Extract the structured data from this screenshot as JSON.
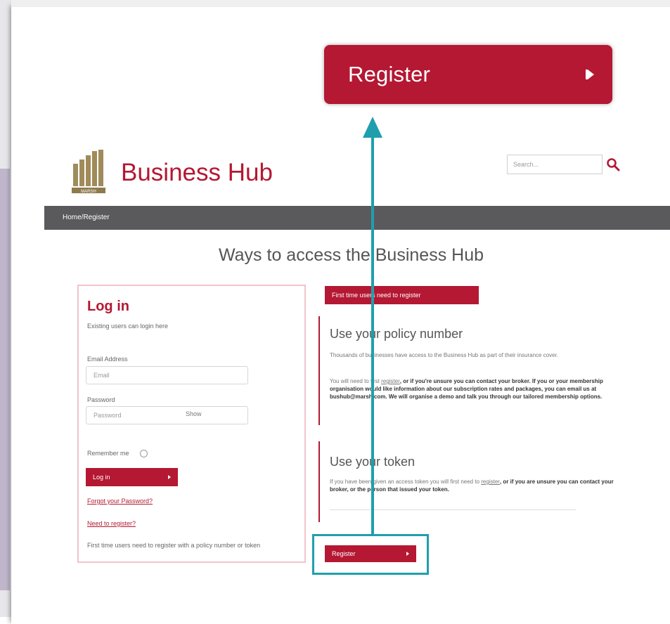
{
  "callout": {
    "register_label": "Register"
  },
  "header": {
    "logo_text": "MARSH",
    "site_title": "Business Hub",
    "search_placeholder": "Search..."
  },
  "breadcrumb": "Home/Register",
  "page_heading": "Ways to access the Business Hub",
  "login": {
    "title": "Log in",
    "subtitle": "Existing users can login here",
    "email_label": "Email Address",
    "email_placeholder": "Email",
    "password_label": "Password",
    "password_placeholder": "Password",
    "show_label": "Show",
    "remember_label": "Remember me",
    "login_button": "Log in",
    "forgot_link": "Forgot your Password?",
    "register_link": "Need to register?",
    "footer_text": "First time users need to register with a policy number or token"
  },
  "register_panel": {
    "first_time_label": "First time users need to register",
    "policy": {
      "title": "Use your policy number",
      "p1": "Thousands of businesses have access to the Business Hub as part of their insurance cover.",
      "p2_start": "You will need to first ",
      "p2_link": "register",
      "p2_end": ", or if you're unsure you can contact your broker. If you or your membership organisation would like information about our subscription rates and packages, you can email us at bushub@marsh.com. We will organise a demo and talk you through our tailored membership options."
    },
    "token": {
      "title": "Use your token",
      "p_start": "If you have been given an access token you will first need to ",
      "p_link": "register",
      "p_end": ", or if you are unsure you can contact your broker, or the person that issued your token."
    },
    "register_button": "Register"
  },
  "colors": {
    "brand_red": "#b41833",
    "annotation_teal": "#1f9fad",
    "breadcrumb_bar": "#5a5a5c"
  }
}
